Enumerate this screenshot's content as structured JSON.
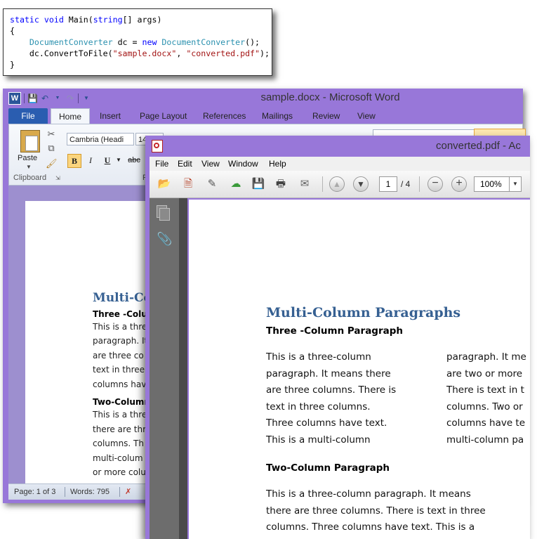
{
  "code": {
    "line1": {
      "kw1": "static",
      "kw2": "void",
      "rest": " Main(",
      "kw3": "string",
      "rest2": "[] args)"
    },
    "line2": "{",
    "line3": {
      "type1": "DocumentConverter",
      "mid": " dc = ",
      "kw": "new",
      "type2": "DocumentConverter",
      "end": "();"
    },
    "line4": {
      "start": "dc.ConvertToFile(",
      "arg1": "\"sample.docx\"",
      "sep": ", ",
      "arg2": "\"converted.pdf\"",
      "end": ");"
    },
    "line5": "}"
  },
  "word": {
    "title": "sample.docx - Microsoft Word",
    "logo": "W",
    "tabs": [
      "File",
      "Home",
      "Insert",
      "Page Layout",
      "References",
      "Mailings",
      "Review",
      "View"
    ],
    "ribbon": {
      "paste_label": "Paste",
      "clipboard_label": "Clipboard",
      "font_name": "Cambria (Headi",
      "font_size": "14",
      "bold": "B",
      "italic": "I",
      "underline": "U",
      "strike": "abc",
      "font_group_label": "F"
    },
    "doc": {
      "heading": "Multi-Co",
      "sub1": "Three -Colu",
      "lines1": [
        "This is a thre",
        "paragraph. It",
        "are three co",
        "text in three",
        "columns hav"
      ],
      "sub2": "Two-Column",
      "lines2": [
        "This is a thre",
        "there are thr",
        "columns. Th",
        "multi-colum",
        "or more colu"
      ]
    },
    "status": {
      "page": "Page: 1 of 3",
      "words": "Words: 795"
    }
  },
  "acrobat": {
    "title": "converted.pdf - Ac",
    "menu": [
      "File",
      "Edit",
      "View",
      "Window",
      "Help"
    ],
    "toolbar": {
      "page_current": "1",
      "page_total": "/ 4",
      "zoom": "100%"
    },
    "doc": {
      "heading": "Multi-Column Paragraphs",
      "sub1": "Three -Column Paragraph",
      "col1": [
        "This is a three-column",
        "paragraph. It means there",
        "are three columns. There is",
        "text in three columns.",
        "Three columns have text.",
        "This is a multi-column"
      ],
      "col2": [
        "paragraph. It me",
        "are two or more",
        "There is text in t",
        "columns. Two or",
        "columns have te",
        "multi-column pa"
      ],
      "sub2": "Two-Column Paragraph",
      "para2": [
        "This is a three-column paragraph. It means",
        "there are three columns. There is text in three",
        "columns. Three columns have text. This is a"
      ]
    }
  },
  "colors": {
    "accent_purple": "#9877d9",
    "heading_blue": "#366092",
    "word_file_tab": "#2a5db0"
  }
}
